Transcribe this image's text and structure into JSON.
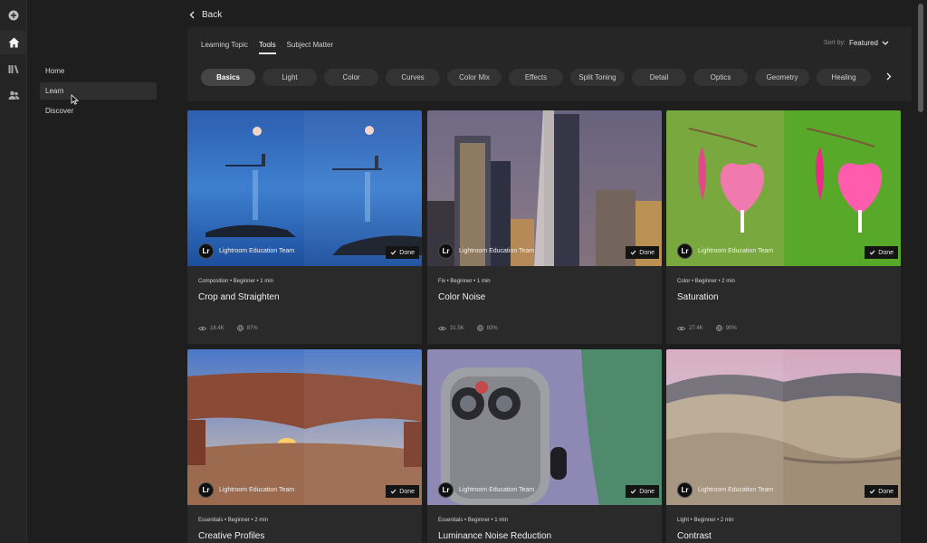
{
  "rail": {
    "icons": [
      "add-icon",
      "home-icon",
      "library-icon",
      "people-icon"
    ]
  },
  "sidenav": {
    "items": [
      {
        "label": "Home"
      },
      {
        "label": "Learn"
      },
      {
        "label": "Discover"
      }
    ]
  },
  "header": {
    "back_label": "Back"
  },
  "tabs": [
    {
      "label": "Learning Topic"
    },
    {
      "label": "Tools"
    },
    {
      "label": "Subject Matter"
    }
  ],
  "sort": {
    "label": "Sort by:",
    "value": "Featured"
  },
  "chips": [
    "Basics",
    "Light",
    "Color",
    "Curves",
    "Color Mix",
    "Effects",
    "Split Toning",
    "Detail",
    "Optics",
    "Geometry",
    "Healing"
  ],
  "cards": [
    {
      "meta": "Composition • Beginner • 1 min",
      "title": "Crop and Straighten",
      "author": "Lightroom Education Team",
      "badge": "Done",
      "views": "18.4K",
      "completion": "87%"
    },
    {
      "meta": "Fix • Beginner • 1 min",
      "title": "Color Noise",
      "author": "Lightroom Education Team",
      "badge": "Done",
      "views": "31.5K",
      "completion": "83%"
    },
    {
      "meta": "Color • Beginner • 2 min",
      "title": "Saturation",
      "author": "Lightroom Education Team",
      "badge": "Done",
      "views": "27.4K",
      "completion": "90%"
    },
    {
      "meta": "Essentials • Beginner • 2 min",
      "title": "Creative Profiles",
      "author": "Lightroom Education Team",
      "badge": "Done",
      "views": "",
      "completion": ""
    },
    {
      "meta": "Essentials • Beginner • 1 min",
      "title": "Luminance Noise Reduction",
      "author": "Lightroom Education Team",
      "badge": "Done",
      "views": "",
      "completion": ""
    },
    {
      "meta": "Light • Beginner • 2 min",
      "title": "Contrast",
      "author": "Lightroom Education Team",
      "badge": "Done",
      "views": "",
      "completion": ""
    }
  ],
  "logo_text": "Lr"
}
